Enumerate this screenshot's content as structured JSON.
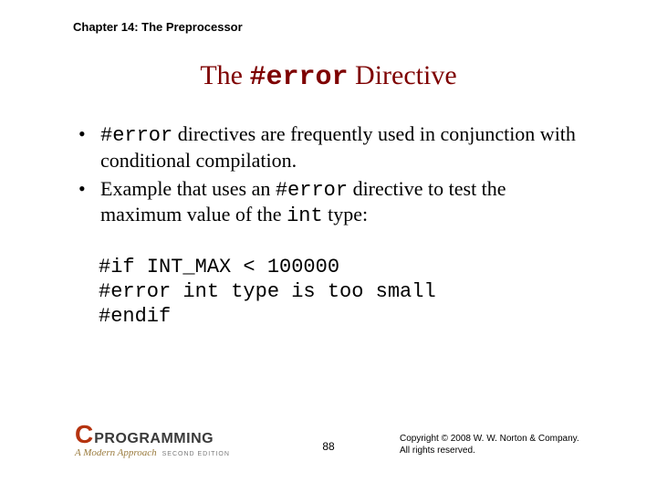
{
  "header": {
    "chapter": "Chapter 14: The Preprocessor"
  },
  "title": {
    "pre": "The ",
    "code": "#error",
    "post": " Directive"
  },
  "bullets": [
    {
      "seg1_code": "#error",
      "seg1_post": " directives are frequently used in conjunction with conditional compilation."
    },
    {
      "seg2_pre": "Example that uses an ",
      "seg2_code1": "#error",
      "seg2_mid": " directive to test the maximum value of the ",
      "seg2_code2": "int",
      "seg2_post": " type:"
    }
  ],
  "code_block": "#if INT_MAX < 100000\n#error int type is too small\n#endif",
  "footer": {
    "logo_c": "C",
    "logo_prog": "PROGRAMMING",
    "logo_sub": "A Modern Approach",
    "logo_ed": "SECOND EDITION",
    "page": "88",
    "copyright_l1": "Copyright © 2008 W. W. Norton & Company.",
    "copyright_l2": "All rights reserved."
  }
}
